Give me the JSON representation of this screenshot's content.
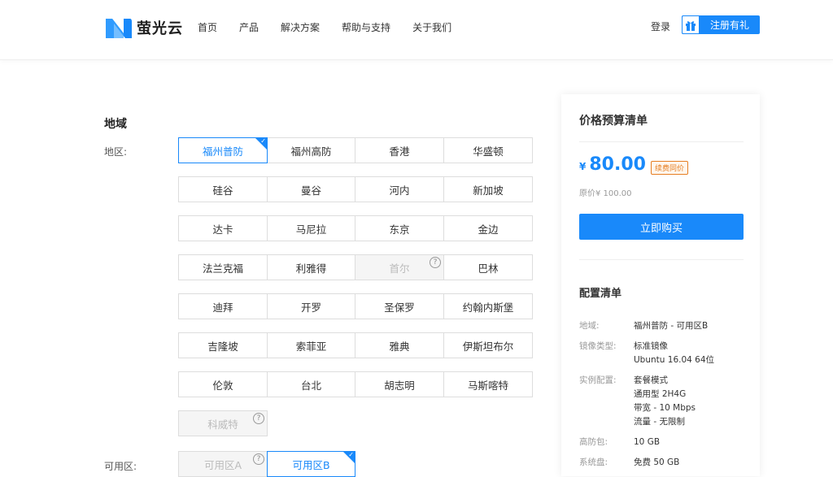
{
  "header": {
    "logo_text": "萤光云",
    "nav": [
      "首页",
      "产品",
      "解决方案",
      "帮助与支持",
      "关于我们"
    ],
    "login": "登录",
    "register": "注册有礼",
    "brand_color": "#1989fa"
  },
  "region": {
    "section_title": "地域",
    "area_label": "地区:",
    "zone_label": "可用区:",
    "rows": [
      [
        {
          "name": "福州普防",
          "state": "selected"
        },
        {
          "name": "福州高防",
          "state": "normal"
        },
        {
          "name": "香港",
          "state": "normal"
        },
        {
          "name": "华盛顿",
          "state": "normal"
        }
      ],
      [
        {
          "name": "硅谷",
          "state": "normal"
        },
        {
          "name": "曼谷",
          "state": "normal"
        },
        {
          "name": "河内",
          "state": "normal"
        },
        {
          "name": "新加坡",
          "state": "normal"
        }
      ],
      [
        {
          "name": "达卡",
          "state": "normal"
        },
        {
          "name": "马尼拉",
          "state": "normal"
        },
        {
          "name": "东京",
          "state": "normal"
        },
        {
          "name": "金边",
          "state": "normal"
        }
      ],
      [
        {
          "name": "法兰克福",
          "state": "normal"
        },
        {
          "name": "利雅得",
          "state": "normal"
        },
        {
          "name": "首尔",
          "state": "disabled"
        },
        {
          "name": "巴林",
          "state": "normal"
        }
      ],
      [
        {
          "name": "迪拜",
          "state": "normal"
        },
        {
          "name": "开罗",
          "state": "normal"
        },
        {
          "name": "圣保罗",
          "state": "normal"
        },
        {
          "name": "约翰内斯堡",
          "state": "normal"
        }
      ],
      [
        {
          "name": "吉隆坡",
          "state": "normal"
        },
        {
          "name": "索菲亚",
          "state": "normal"
        },
        {
          "name": "雅典",
          "state": "normal"
        },
        {
          "name": "伊斯坦布尔",
          "state": "normal"
        }
      ],
      [
        {
          "name": "伦敦",
          "state": "normal"
        },
        {
          "name": "台北",
          "state": "normal"
        },
        {
          "name": "胡志明",
          "state": "normal"
        },
        {
          "name": "马斯喀特",
          "state": "normal"
        }
      ],
      [
        {
          "name": "科威特",
          "state": "disabled"
        }
      ]
    ],
    "zones": [
      {
        "name": "可用区A",
        "state": "disabled"
      },
      {
        "name": "可用区B",
        "state": "selected"
      }
    ]
  },
  "summary": {
    "title": "价格预算清单",
    "currency": "¥",
    "price": "80.00",
    "badge": "续费同价",
    "original": "原价¥ 100.00",
    "buy": "立即购买",
    "config_title": "配置清单",
    "items": [
      {
        "key": "地域:",
        "vals": [
          "福州普防 - 可用区B"
        ]
      },
      {
        "key": "镜像类型:",
        "vals": [
          "标准镜像",
          "Ubuntu 16.04 64位"
        ]
      },
      {
        "key": "实例配置:",
        "vals": [
          "套餐模式",
          "通用型 2H4G",
          "带宽 - 10 Mbps",
          "流量 - 无限制"
        ]
      },
      {
        "key": "高防包:",
        "vals": [
          "10 GB"
        ]
      },
      {
        "key": "系统盘:",
        "vals": [
          "免费 50 GB"
        ]
      }
    ]
  }
}
